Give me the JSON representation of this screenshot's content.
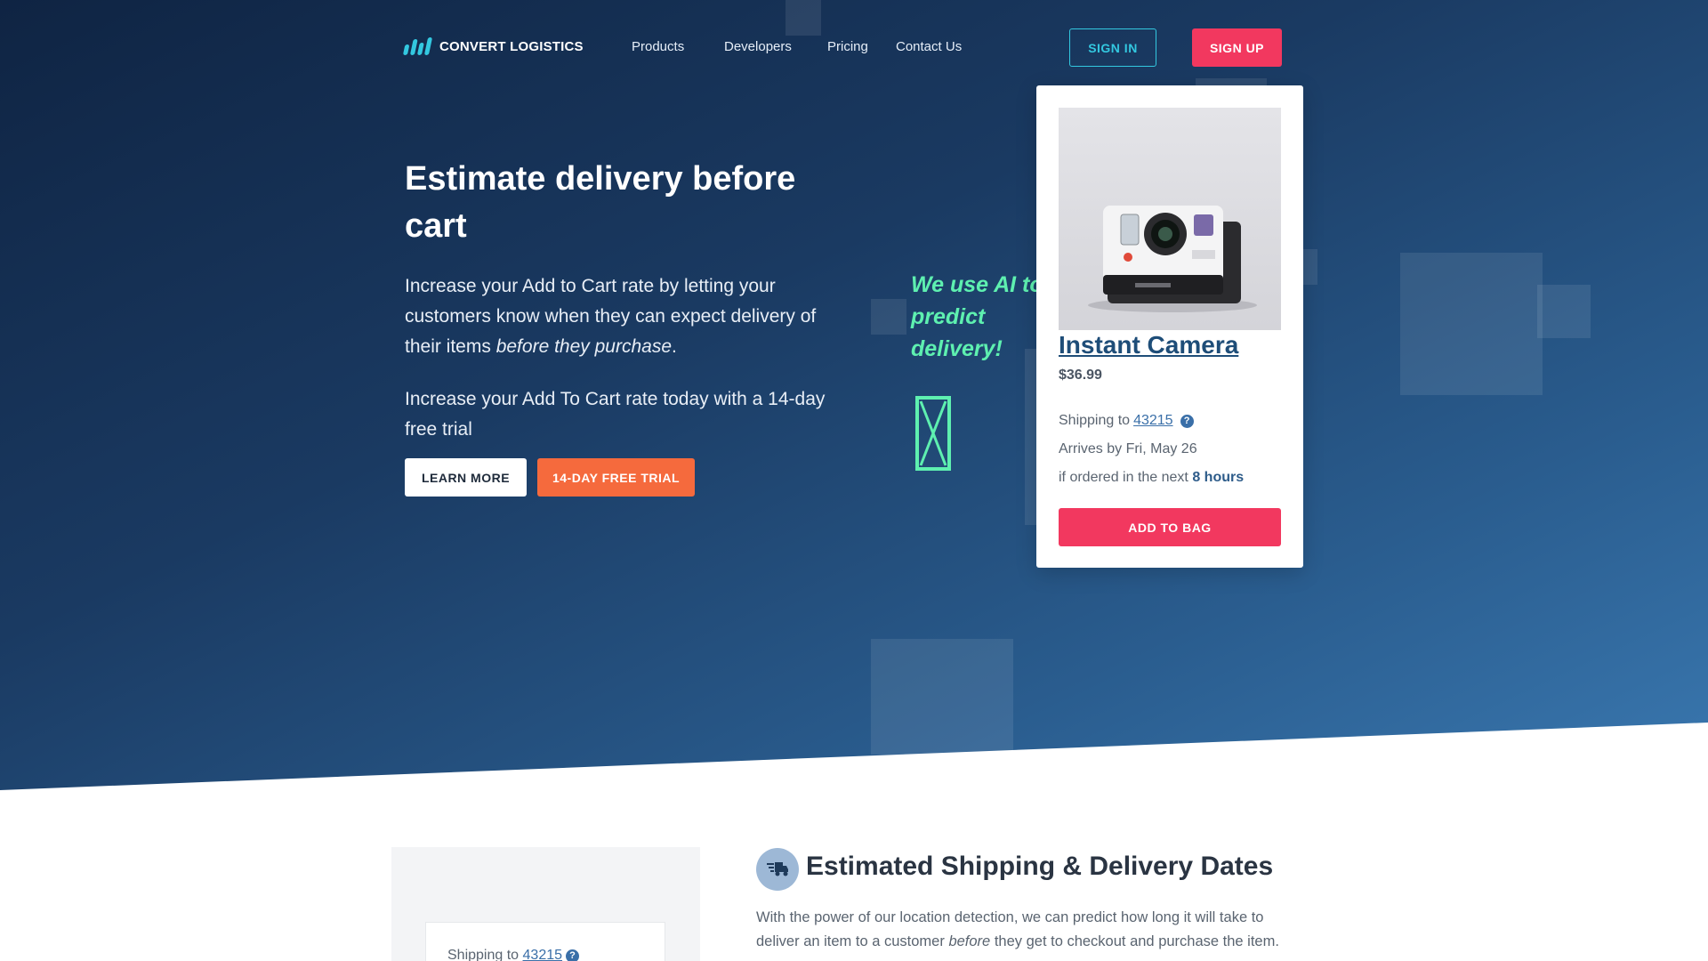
{
  "brand": {
    "name": "CONVERT LOGISTICS",
    "accent": "#33c8e0",
    "cta_color": "#f2385f",
    "trial_color": "#f56a3d"
  },
  "nav": {
    "links": [
      "Products",
      "Developers",
      "Pricing",
      "Contact Us"
    ],
    "sign_in": "SIGN IN",
    "sign_up": "SIGN UP"
  },
  "hero": {
    "title": "Estimate delivery before cart",
    "paragraph1_start": "Increase your Add to Cart rate by letting your customers know when they can expect delivery of their items ",
    "paragraph1_emphasis": "before they purchase",
    "paragraph1_end": ".",
    "paragraph2": "Increase your Add To Cart rate today with a 14-day free trial",
    "learn_more": "LEARN MORE",
    "free_trial": "14-DAY FREE TRIAL"
  },
  "ai_note": {
    "text": "We use AI to predict delivery!",
    "icon": "hourglass-icon"
  },
  "product_card": {
    "image": "instant-camera-photo",
    "title": "Instant Camera",
    "price": "$36.99",
    "shipping_label": "Shipping to",
    "zip": "43215",
    "help": "?",
    "arrival": "Arrives by Fri, May 26",
    "order_prefix": "if ordered in the next",
    "order_time": "8 hours",
    "add_to_bag": "ADD TO BAG"
  },
  "feature": {
    "icon": "delivery-truck-icon",
    "title": "Estimated Shipping & Delivery Dates",
    "text_start": "With the power of our location detection, we can predict how long it will take to deliver an item to a customer ",
    "text_emphasis": "before",
    "text_end": " they get to checkout and purchase the item."
  },
  "demo_widget": {
    "shipping_label": "Shipping to",
    "zip": "43215",
    "help": "?"
  }
}
